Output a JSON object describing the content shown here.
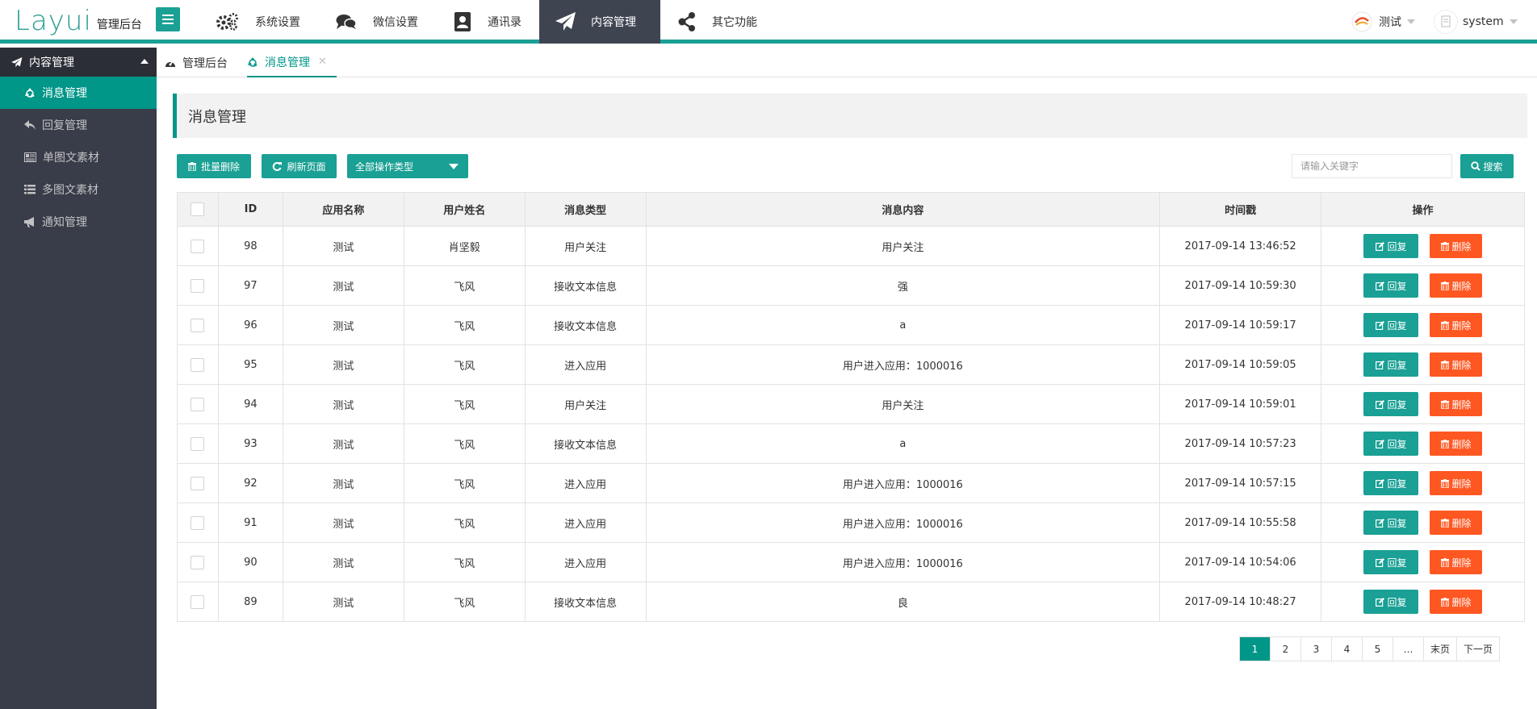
{
  "header": {
    "logo": "Layui",
    "logo_sub": "管理后台",
    "nav": [
      {
        "label": "系统设置",
        "icon": "gears-icon"
      },
      {
        "label": "微信设置",
        "icon": "comments-icon"
      },
      {
        "label": "通讯录",
        "icon": "address-book-icon"
      },
      {
        "label": "内容管理",
        "icon": "paper-plane-icon",
        "active": true
      },
      {
        "label": "其它功能",
        "icon": "share-icon"
      }
    ],
    "account_name": "测试",
    "user_name": "system"
  },
  "sidebar": {
    "section": "内容管理",
    "items": [
      {
        "label": "消息管理",
        "icon": "recycle-icon",
        "active": true
      },
      {
        "label": "回复管理",
        "icon": "reply-icon"
      },
      {
        "label": "单图文素材",
        "icon": "newspaper-icon"
      },
      {
        "label": "多图文素材",
        "icon": "list-icon"
      },
      {
        "label": "通知管理",
        "icon": "bullhorn-icon"
      }
    ]
  },
  "tabs": [
    {
      "label": "管理后台",
      "icon": "dashboard-icon"
    },
    {
      "label": "消息管理",
      "icon": "recycle-icon",
      "active": true,
      "close": "✕"
    }
  ],
  "page": {
    "title": "消息管理",
    "batch_delete": "批量删除",
    "refresh": "刷新页面",
    "filter_selected": "全部操作类型",
    "search_placeholder": "请输入关键字",
    "search_button": "搜索"
  },
  "table": {
    "headers": [
      "ID",
      "应用名称",
      "用户姓名",
      "消息类型",
      "消息内容",
      "时间戳",
      "操作"
    ],
    "reply_label": "回复",
    "delete_label": "删除",
    "rows": [
      {
        "id": "98",
        "app": "测试",
        "user": "肖坚毅",
        "type": "用户关注",
        "content": "用户关注",
        "time": "2017-09-14 13:46:52"
      },
      {
        "id": "97",
        "app": "测试",
        "user": "飞风",
        "type": "接收文本信息",
        "content": "强",
        "time": "2017-09-14 10:59:30"
      },
      {
        "id": "96",
        "app": "测试",
        "user": "飞风",
        "type": "接收文本信息",
        "content": "a",
        "time": "2017-09-14 10:59:17"
      },
      {
        "id": "95",
        "app": "测试",
        "user": "飞风",
        "type": "进入应用",
        "content": "用户进入应用：1000016",
        "time": "2017-09-14 10:59:05"
      },
      {
        "id": "94",
        "app": "测试",
        "user": "飞风",
        "type": "用户关注",
        "content": "用户关注",
        "time": "2017-09-14 10:59:01"
      },
      {
        "id": "93",
        "app": "测试",
        "user": "飞风",
        "type": "接收文本信息",
        "content": "a",
        "time": "2017-09-14 10:57:23"
      },
      {
        "id": "92",
        "app": "测试",
        "user": "飞风",
        "type": "进入应用",
        "content": "用户进入应用：1000016",
        "time": "2017-09-14 10:57:15"
      },
      {
        "id": "91",
        "app": "测试",
        "user": "飞风",
        "type": "进入应用",
        "content": "用户进入应用：1000016",
        "time": "2017-09-14 10:55:58"
      },
      {
        "id": "90",
        "app": "测试",
        "user": "飞风",
        "type": "进入应用",
        "content": "用户进入应用：1000016",
        "time": "2017-09-14 10:54:06"
      },
      {
        "id": "89",
        "app": "测试",
        "user": "飞风",
        "type": "接收文本信息",
        "content": "良",
        "time": "2017-09-14 10:48:27"
      }
    ]
  },
  "pagination": {
    "pages": [
      "1",
      "2",
      "3",
      "4",
      "5",
      "…",
      "末页",
      "下一页"
    ],
    "current": "1"
  },
  "colors": {
    "accent": "#009688",
    "button": "#1aa094",
    "danger": "#ff5722",
    "sidebar": "#393d49"
  }
}
